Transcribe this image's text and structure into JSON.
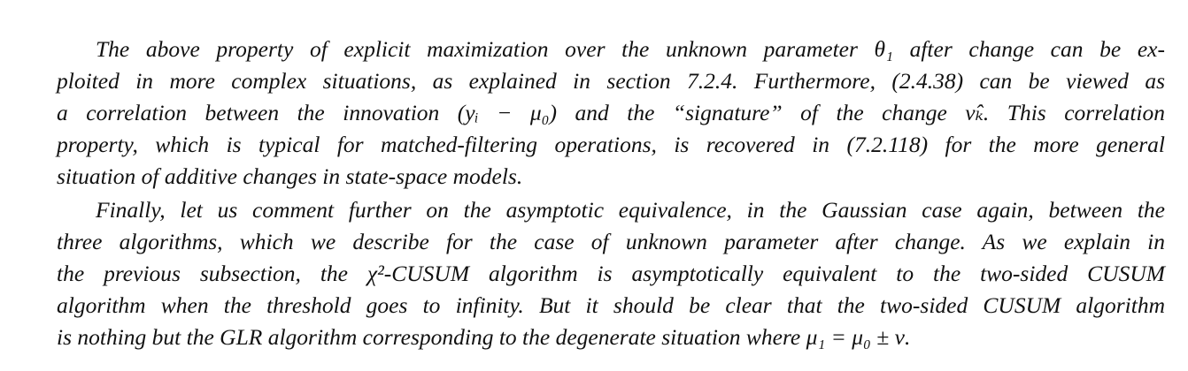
{
  "paragraphs": [
    {
      "lines": [
        "The above property of explicit maximization over the unknown parameter θ₁ after change can be ex-",
        "ploited in more complex situations, as explained in section 7.2.4. Furthermore, (2.4.38) can be viewed as",
        "a correlation between the innovation (yᵢ − μ₀) and the “signature” of the change ν̂ₖ. This correlation",
        "property, which is typical for matched-filtering operations, is recovered in (7.2.118) for the more general",
        "situation of additive changes in state-space models."
      ]
    },
    {
      "lines": [
        "Finally, let us comment further on the asymptotic equivalence, in the Gaussian case again, between the",
        "three algorithms, which we describe for the case of unknown parameter after change. As we explain in",
        "the previous subsection, the χ²-CUSUM algorithm is asymptotically equivalent to the two-sided CUSUM",
        "algorithm when the threshold goes to infinity. But it should be clear that the two-sided CUSUM algorithm",
        "is nothing but the GLR algorithm corresponding to the degenerate situation where μ₁ = μ₀ ± ν."
      ]
    }
  ]
}
